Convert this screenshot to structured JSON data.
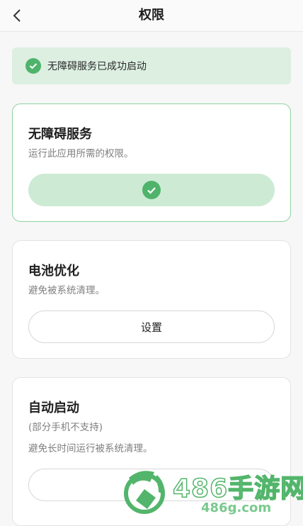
{
  "header": {
    "title": "权限",
    "back_icon": "chevron-left-icon"
  },
  "banner": {
    "text": "无障碍服务已成功启动",
    "icon": "check-circle-icon",
    "color": "#4fb36c"
  },
  "cards": [
    {
      "title": "无障碍服务",
      "description": "运行此应用所需的权限。",
      "status": "enabled",
      "icon": "check-circle-icon"
    },
    {
      "title": "电池优化",
      "description": "避免被系统清理。",
      "button_label": "设置"
    },
    {
      "title": "自动启动",
      "note": "(部分手机不支持)",
      "description": "避免长时间运行被系统清理。",
      "button_label": ""
    }
  ],
  "watermark": {
    "big": "486手游网",
    "small": "486g.com"
  },
  "colors": {
    "accent": "#4fb36c",
    "banner_bg": "#dcefe1",
    "active_border": "#8fd2a2"
  }
}
